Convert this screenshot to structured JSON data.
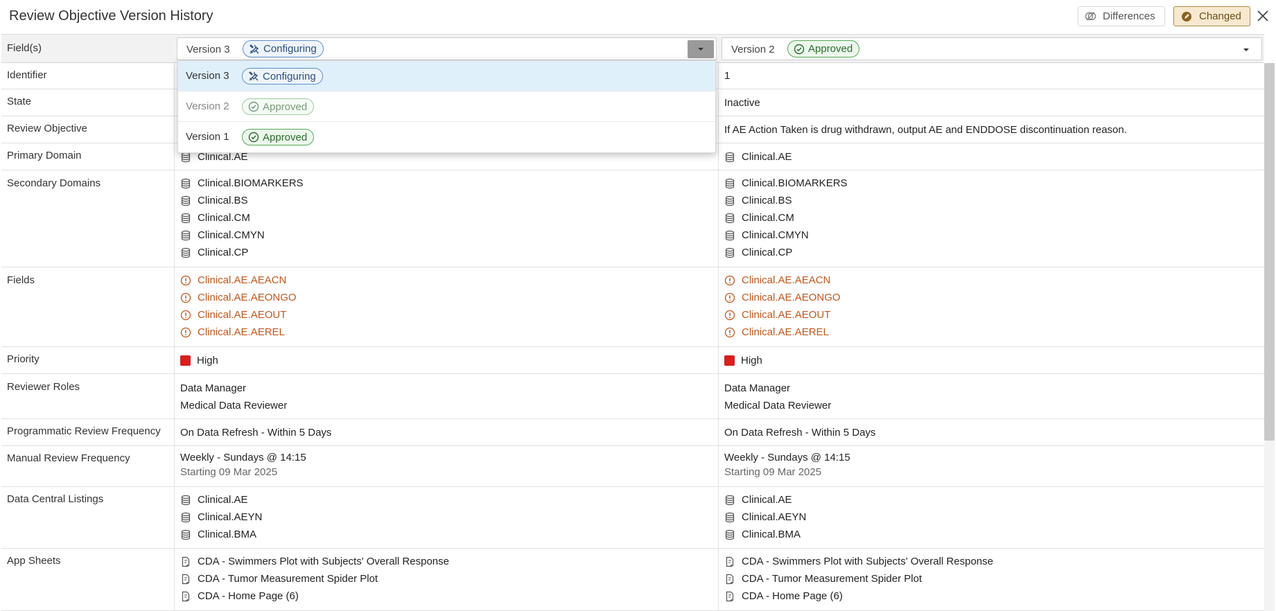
{
  "header": {
    "title": "Review Objective Version History",
    "differences_label": "Differences",
    "changed_label": "Changed"
  },
  "table_header": {
    "fields_label": "Field(s)",
    "left": {
      "version": "Version 3",
      "status": "Configuring"
    },
    "right": {
      "version": "Version 2",
      "status": "Approved"
    }
  },
  "dropdown": {
    "items": [
      {
        "version": "Version 3",
        "status": "Configuring",
        "selected": true
      },
      {
        "version": "Version 2",
        "status": "Approved",
        "disabled": true
      },
      {
        "version": "Version 1",
        "status": "Approved"
      }
    ]
  },
  "rows": {
    "identifier": {
      "label": "Identifier",
      "right": "1"
    },
    "state": {
      "label": "State",
      "right": "Inactive"
    },
    "review_objective": {
      "label": "Review Objective",
      "right": "If AE Action Taken is drug withdrawn, output AE and ENDDOSE discontinuation reason."
    },
    "primary_domain": {
      "label": "Primary Domain",
      "left": "Clinical.AE",
      "right": "Clinical.AE"
    },
    "secondary_domains": {
      "label": "Secondary Domains",
      "left": [
        "Clinical.BIOMARKERS",
        "Clinical.BS",
        "Clinical.CM",
        "Clinical.CMYN",
        "Clinical.CP"
      ],
      "right": [
        "Clinical.BIOMARKERS",
        "Clinical.BS",
        "Clinical.CM",
        "Clinical.CMYN",
        "Clinical.CP"
      ]
    },
    "fields": {
      "label": "Fields",
      "left": [
        "Clinical.AE.AEACN",
        "Clinical.AE.AEONGO",
        "Clinical.AE.AEOUT",
        "Clinical.AE.AEREL"
      ],
      "right": [
        "Clinical.AE.AEACN",
        "Clinical.AE.AEONGO",
        "Clinical.AE.AEOUT",
        "Clinical.AE.AEREL"
      ]
    },
    "priority": {
      "label": "Priority",
      "left": "High",
      "right": "High",
      "color": "#d81e1e"
    },
    "reviewer_roles": {
      "label": "Reviewer Roles",
      "left": [
        "Data Manager",
        "Medical Data Reviewer"
      ],
      "right": [
        "Data Manager",
        "Medical Data Reviewer"
      ]
    },
    "programmatic": {
      "label": "Programmatic Review Frequency",
      "left": "On Data Refresh - Within 5 Days",
      "right": "On Data Refresh - Within 5 Days"
    },
    "manual": {
      "label": "Manual Review Frequency",
      "left": {
        "line1": "Weekly - Sundays @ 14:15",
        "line2": "Starting 09 Mar 2025"
      },
      "right": {
        "line1": "Weekly - Sundays @ 14:15",
        "line2": "Starting 09 Mar 2025"
      }
    },
    "listings": {
      "label": "Data Central Listings",
      "left": [
        "Clinical.AE",
        "Clinical.AEYN",
        "Clinical.BMA"
      ],
      "right": [
        "Clinical.AE",
        "Clinical.AEYN",
        "Clinical.BMA"
      ]
    },
    "app_sheets": {
      "label": "App Sheets",
      "left": [
        "CDA - Swimmers Plot with Subjects' Overall Response",
        "CDA - Tumor Measurement Spider Plot",
        "CDA - Home Page (6)"
      ],
      "right": [
        "CDA - Swimmers Plot with Subjects' Overall Response",
        "CDA - Tumor Measurement Spider Plot",
        "CDA - Home Page (6)"
      ]
    }
  },
  "icons": {
    "database": "database-icon",
    "warning": "alert-circle-icon",
    "sheet": "document-icon",
    "configuring": "tools-icon",
    "approved": "check-circle-icon"
  },
  "colors": {
    "warning": "#c0571b",
    "configuring": "#5e8fc9",
    "approved": "#55a858",
    "changed_bg": "#f7e9cf",
    "selected_row": "#dff0fb"
  }
}
